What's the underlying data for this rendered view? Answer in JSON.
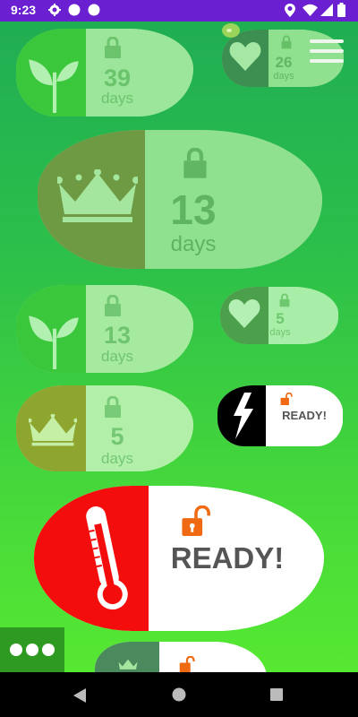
{
  "status_bar": {
    "time": "9:23"
  },
  "challenges": [
    {
      "name": "plant",
      "count": "39",
      "unit": "days"
    },
    {
      "name": "heart",
      "count": "26",
      "unit": "days"
    },
    {
      "name": "crown",
      "count": "13",
      "unit": "days"
    },
    {
      "name": "plant",
      "count": "13",
      "unit": "days"
    },
    {
      "name": "heart",
      "count": "5",
      "unit": "days"
    },
    {
      "name": "crown",
      "count": "5",
      "unit": "days"
    },
    {
      "name": "lightning",
      "status": "READY!"
    },
    {
      "name": "thermometer",
      "status": "READY!"
    }
  ],
  "icons": {
    "menu": "hamburger-menu-icon",
    "more": "more-options-icon",
    "back": "back-icon",
    "home": "home-icon",
    "recents": "recents-icon"
  },
  "colors": {
    "status_bar": "#6a1fd1",
    "ready_lock": "#f06a13",
    "thermometer_panel": "#f40d0d",
    "more_button": "#2e9a22"
  }
}
